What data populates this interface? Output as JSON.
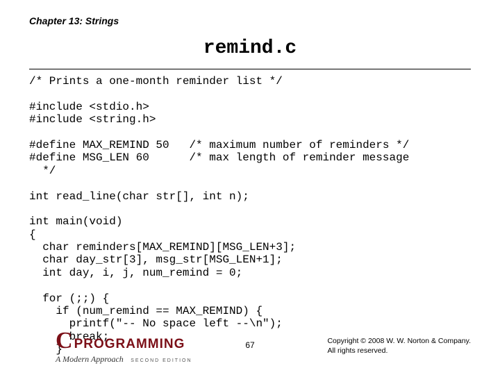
{
  "header": {
    "chapter": "Chapter 13: Strings",
    "title": "remind.c"
  },
  "code": "/* Prints a one-month reminder list */\n\n#include <stdio.h>\n#include <string.h>\n\n#define MAX_REMIND 50   /* maximum number of reminders */\n#define MSG_LEN 60      /* max length of reminder message\n  */\n\nint read_line(char str[], int n);\n\nint main(void)\n{\n  char reminders[MAX_REMIND][MSG_LEN+3];\n  char day_str[3], msg_str[MSG_LEN+1];\n  int day, i, j, num_remind = 0;\n\n  for (;;) {\n    if (num_remind == MAX_REMIND) {\n      printf(\"-- No space left --\\n\");\n      break;\n    }",
  "footer": {
    "logo_c": "C",
    "logo_prog": "PROGRAMMING",
    "logo_sub": "A Modern Approach",
    "logo_edition": "SECOND EDITION",
    "page_number": "67",
    "copyright_line1": "Copyright © 2008 W. W. Norton & Company.",
    "copyright_line2": "All rights reserved."
  }
}
